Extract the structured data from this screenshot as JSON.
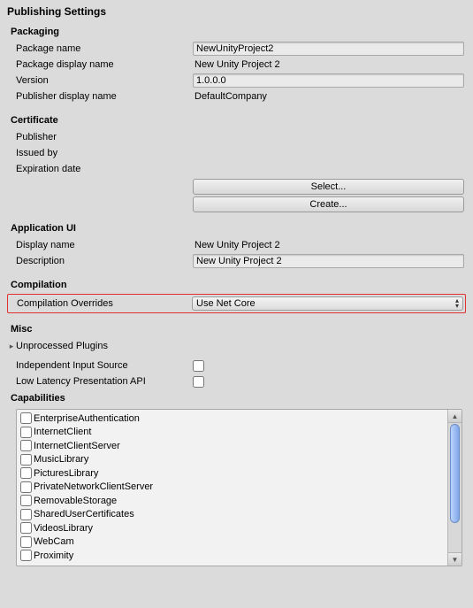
{
  "title": "Publishing Settings",
  "packaging": {
    "heading": "Packaging",
    "package_name_label": "Package name",
    "package_name_value": "NewUnityProject2",
    "package_display_name_label": "Package display name",
    "package_display_name_value": "New Unity Project 2",
    "version_label": "Version",
    "version_value": "1.0.0.0",
    "publisher_display_name_label": "Publisher display name",
    "publisher_display_name_value": "DefaultCompany"
  },
  "certificate": {
    "heading": "Certificate",
    "publisher_label": "Publisher",
    "publisher_value": "",
    "issued_by_label": "Issued by",
    "issued_by_value": "",
    "expiration_label": "Expiration date",
    "expiration_value": "",
    "select_btn": "Select...",
    "create_btn": "Create..."
  },
  "app_ui": {
    "heading": "Application UI",
    "display_name_label": "Display name",
    "display_name_value": "New Unity Project 2",
    "description_label": "Description",
    "description_value": "New Unity Project 2"
  },
  "compilation": {
    "heading": "Compilation",
    "overrides_label": "Compilation Overrides",
    "overrides_value": "Use Net Core"
  },
  "misc": {
    "heading": "Misc",
    "unprocessed_plugins_label": "Unprocessed Plugins",
    "independent_input_label": "Independent Input Source",
    "low_latency_label": "Low Latency Presentation API"
  },
  "capabilities": {
    "heading": "Capabilities",
    "items": [
      "EnterpriseAuthentication",
      "InternetClient",
      "InternetClientServer",
      "MusicLibrary",
      "PicturesLibrary",
      "PrivateNetworkClientServer",
      "RemovableStorage",
      "SharedUserCertificates",
      "VideosLibrary",
      "WebCam",
      "Proximity"
    ]
  }
}
